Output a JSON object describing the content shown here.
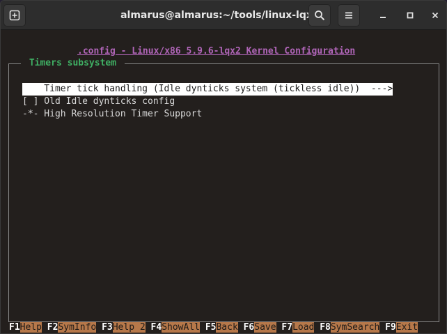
{
  "window": {
    "title": "almarus@almarus:~/tools/linux-lqx"
  },
  "header": {
    "new_tab_icon": "new-tab-icon",
    "search_icon": "search-icon",
    "menu_icon": "hamburger-menu-icon",
    "minimize_icon": "minimize-icon",
    "maximize_icon": "maximize-icon",
    "close_icon": "close-icon"
  },
  "terminal": {
    "config_title": ".config - Linux/x86 5.9.6-lqx2 Kernel Configuration",
    "section_title": " Timers subsystem ",
    "menu": [
      {
        "text": "    Timer tick handling (Idle dynticks system (tickless idle))  --->",
        "selected": true
      },
      {
        "text": "[ ] Old Idle dynticks config",
        "selected": false
      },
      {
        "text": "-*- High Resolution Timer Support",
        "selected": false
      }
    ],
    "function_keys": [
      {
        "key": "F1",
        "label": "Help"
      },
      {
        "key": "F2",
        "label": "SymInfo"
      },
      {
        "key": "F3",
        "label": "Help 2"
      },
      {
        "key": "F4",
        "label": "ShowAll"
      },
      {
        "key": "F5",
        "label": "Back"
      },
      {
        "key": "F6",
        "label": "Save"
      },
      {
        "key": "F7",
        "label": "Load"
      },
      {
        "key": "F8",
        "label": "SymSearch"
      },
      {
        "key": "F9",
        "label": "Exit"
      }
    ]
  },
  "colors": {
    "title_magenta": "#b065b8",
    "section_green": "#3fae63",
    "fkey_label_bg": "#b6784a",
    "terminal_bg": "#231f1d"
  }
}
